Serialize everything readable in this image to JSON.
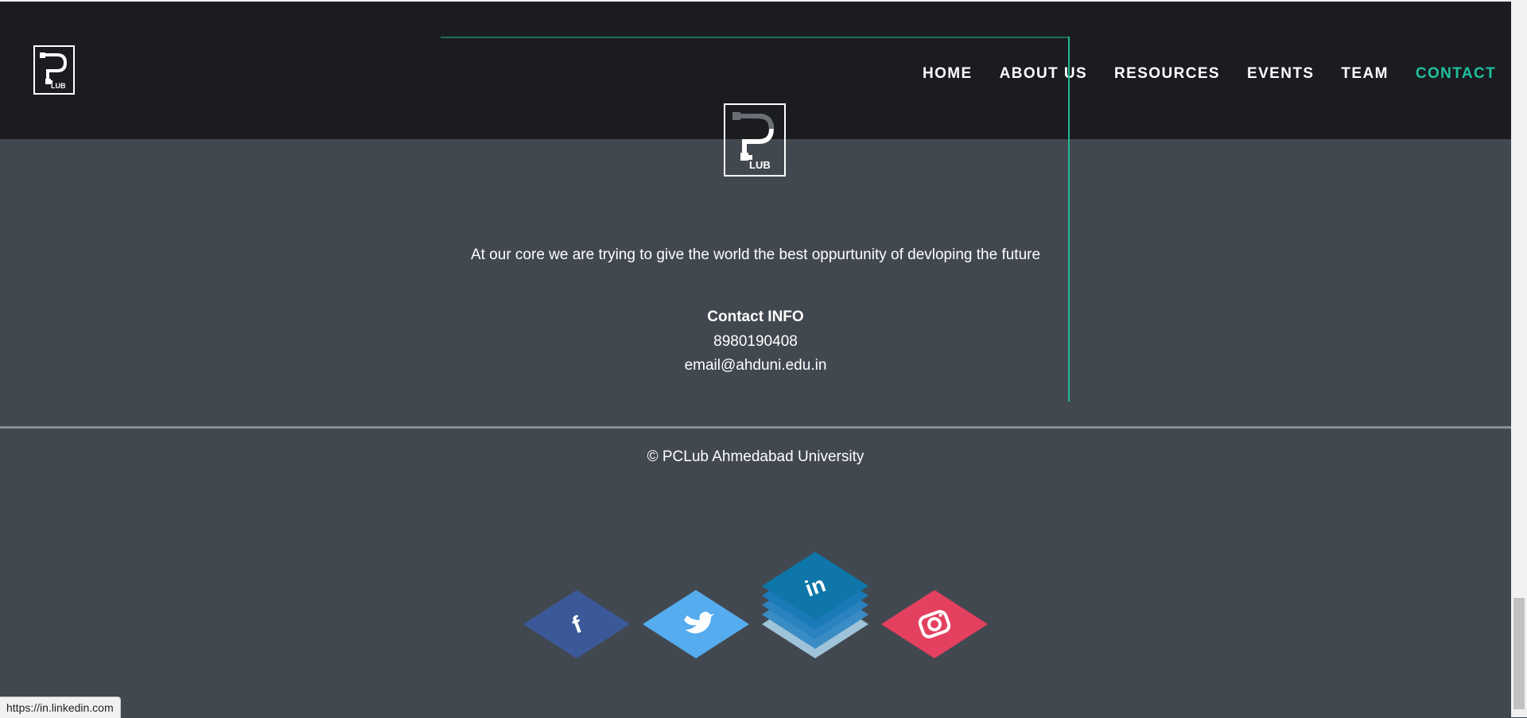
{
  "nav": {
    "items": [
      {
        "label": "HOME",
        "active": false
      },
      {
        "label": "ABOUT US",
        "active": false
      },
      {
        "label": "RESOURCES",
        "active": false
      },
      {
        "label": "EVENTS",
        "active": false
      },
      {
        "label": "TEAM",
        "active": false
      },
      {
        "label": "CONTACT",
        "active": true
      }
    ]
  },
  "logo": {
    "text": "LUB"
  },
  "footer": {
    "tagline": "At our core we are trying to give the world the best oppurtunity of devloping the future",
    "contact_title": "Contact INFO",
    "phone": "8980190408",
    "email": "email@ahduni.edu.in",
    "copyright": "© PCLub Ahmedabad University"
  },
  "social": [
    {
      "name": "facebook",
      "icon": "facebook-icon",
      "glyph": "f",
      "color": "#3b5998"
    },
    {
      "name": "twitter",
      "icon": "twitter-icon",
      "glyph": "",
      "color": "#55acee"
    },
    {
      "name": "linkedin",
      "icon": "linkedin-icon",
      "glyph": "in",
      "color": "#0e76a8"
    },
    {
      "name": "instagram",
      "icon": "instagram-icon",
      "glyph": "",
      "color": "#e4405f"
    }
  ],
  "status_bar": {
    "url": "https://in.linkedin.com"
  },
  "colors": {
    "accent": "#1fc1a0",
    "header_bg": "#1b1c20",
    "page_bg": "#424850"
  }
}
